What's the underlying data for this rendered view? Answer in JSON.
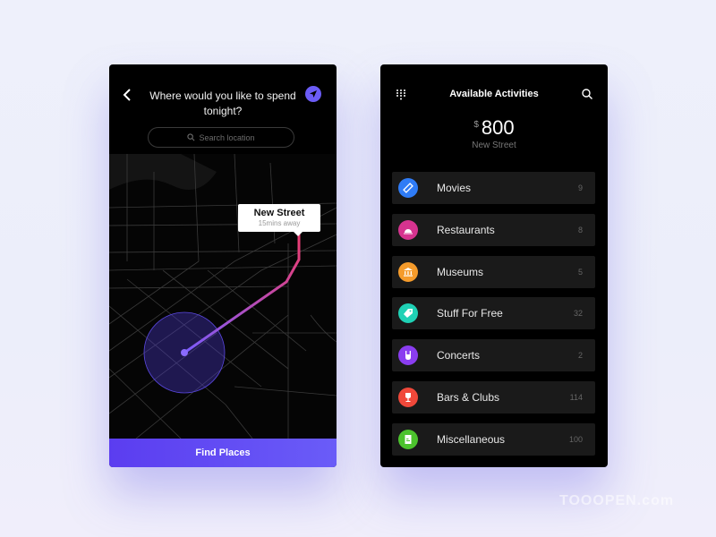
{
  "left_screen": {
    "question": "Where would you like to spend tonight?",
    "search_placeholder": "Search location",
    "destination": {
      "name": "New Street",
      "eta": "15mins away"
    },
    "find_button": "Find Places",
    "accent_color": "#6b5cf6",
    "route_gradient": [
      "#6b5cf6",
      "#f23b6a"
    ]
  },
  "right_screen": {
    "title": "Available Activities",
    "currency": "$",
    "amount": "800",
    "location": "New Street",
    "activities": [
      {
        "label": "Movies",
        "count": "9",
        "icon": "ticket-icon",
        "color": "#2f7cf6"
      },
      {
        "label": "Restaurants",
        "count": "8",
        "icon": "cloche-icon",
        "color": "#d6338f"
      },
      {
        "label": "Museums",
        "count": "5",
        "icon": "museum-icon",
        "color": "#f59b2b"
      },
      {
        "label": "Stuff For Free",
        "count": "32",
        "icon": "tag-icon",
        "color": "#1fd1b5"
      },
      {
        "label": "Concerts",
        "count": "2",
        "icon": "rock-hand-icon",
        "color": "#8a3df0"
      },
      {
        "label": "Bars & Clubs",
        "count": "114",
        "icon": "wine-glass-icon",
        "color": "#f0483a"
      },
      {
        "label": "Miscellaneous",
        "count": "100",
        "icon": "notepad-icon",
        "color": "#4cc32d"
      }
    ]
  },
  "watermark": "TOOOPEN.com"
}
